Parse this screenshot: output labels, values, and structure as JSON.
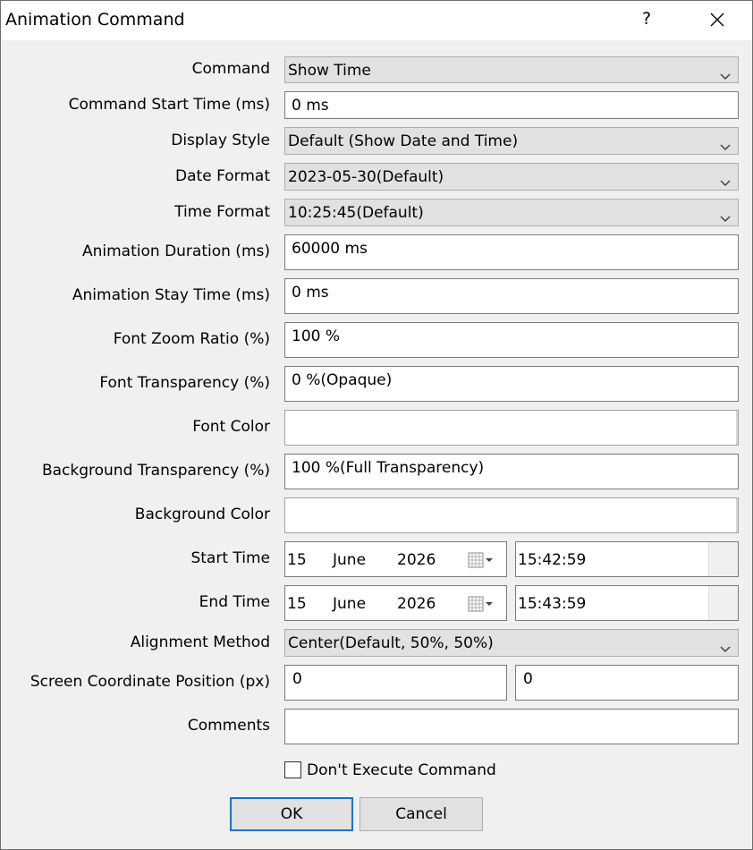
{
  "window": {
    "title": "Animation Command",
    "help_glyph": "?",
    "close_icon": "close-icon"
  },
  "fields": {
    "command": {
      "label": "Command",
      "value": "Show Time"
    },
    "command_start_time": {
      "label": "Command Start Time (ms)",
      "value": "0 ms"
    },
    "display_style": {
      "label": "Display Style",
      "value": "Default (Show Date and Time)"
    },
    "date_format": {
      "label": "Date Format",
      "value": "2023-05-30(Default)"
    },
    "time_format": {
      "label": "Time Format",
      "value": "10:25:45(Default)"
    },
    "animation_duration": {
      "label": "Animation Duration (ms)",
      "value": "60000 ms"
    },
    "animation_stay_time": {
      "label": "Animation Stay Time (ms)",
      "value": "0 ms"
    },
    "font_zoom_ratio": {
      "label": "Font Zoom Ratio (%)",
      "value": "100 %"
    },
    "font_transparency": {
      "label": "Font Transparency (%)",
      "value": "0 %(Opaque)"
    },
    "font_color": {
      "label": "Font Color",
      "value": ""
    },
    "background_transparency": {
      "label": "Background Transparency (%)",
      "value": "100 %(Full Transparency)"
    },
    "background_color": {
      "label": "Background Color",
      "value": ""
    },
    "start_time": {
      "label": "Start Time",
      "day": "15",
      "month": "June",
      "year": "2026",
      "time": "15:42:59"
    },
    "end_time": {
      "label": "End Time",
      "day": "15",
      "month": "June",
      "year": "2026",
      "time": "15:43:59"
    },
    "alignment_method": {
      "label": "Alignment Method",
      "value": "Center(Default, 50%, 50%)"
    },
    "screen_position": {
      "label": "Screen Coordinate Position (px)",
      "x": "0",
      "y": "0"
    },
    "comments": {
      "label": "Comments",
      "value": ""
    }
  },
  "dont_execute": {
    "label": "Don't Execute Command",
    "checked": false
  },
  "buttons": {
    "ok": "OK",
    "cancel": "Cancel"
  },
  "colors": {
    "accent": "#0078d7",
    "dialog_bg": "#f0f0f0",
    "combo_bg": "#e1e1e1"
  }
}
